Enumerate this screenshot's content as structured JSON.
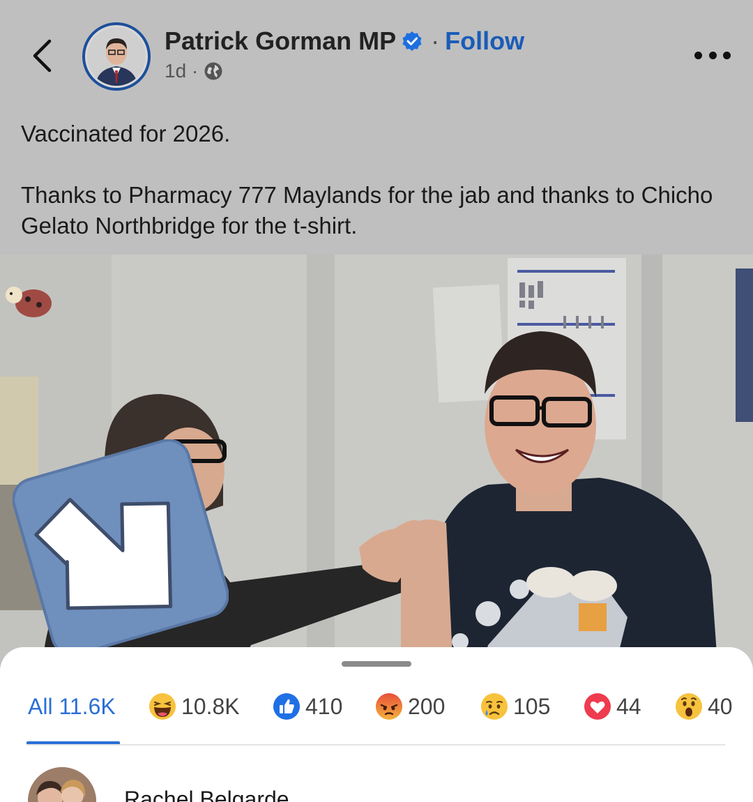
{
  "header": {
    "author_name": "Patrick Gorman MP",
    "separator": "·",
    "follow_label": "Follow",
    "timestamp": "1d ·",
    "icons": [
      "back-chevron-icon",
      "verified-badge-icon",
      "globe-icon",
      "more-options-icon"
    ]
  },
  "post": {
    "line1": "Vaccinated for 2026.",
    "line2": "Thanks to Pharmacy 777 Maylands for the jab and thanks to Chicho Gelato Northbridge for the t-shirt."
  },
  "reactions": {
    "tabs": [
      {
        "key": "all",
        "label": "All 11.6K"
      },
      {
        "key": "haha",
        "count": "10.8K",
        "icon": "haha-emoji-icon"
      },
      {
        "key": "like",
        "count": "410",
        "icon": "like-emoji-icon"
      },
      {
        "key": "angry",
        "count": "200",
        "icon": "angry-emoji-icon"
      },
      {
        "key": "sad",
        "count": "105",
        "icon": "sad-emoji-icon"
      },
      {
        "key": "love",
        "count": "44",
        "icon": "love-emoji-icon"
      },
      {
        "key": "wow",
        "count": "40",
        "icon": "wow-emoji-icon"
      }
    ],
    "first_reactor": "Rachel Belgarde"
  },
  "colors": {
    "accent": "#2a6fd6",
    "follow": "#1a5cb8",
    "dim_background": "#bfbfbf",
    "sheet": "#ffffff"
  }
}
